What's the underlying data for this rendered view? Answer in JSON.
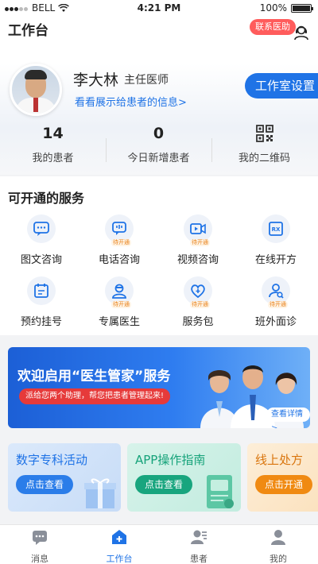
{
  "status_bar": {
    "carrier": "BELL",
    "time": "4:21 PM",
    "battery": "100%"
  },
  "header": {
    "title": "工作台",
    "contact_button": "联系医助",
    "support_icon": "headset-user-icon",
    "doctor": {
      "name": "李大林",
      "position": "主任医师",
      "info_link": "看看展示给患者的信息>"
    },
    "studio_button": "工作室设置",
    "stats": [
      {
        "value": "14",
        "label": "我的患者"
      },
      {
        "value": "0",
        "label": "今日新增患者"
      },
      {
        "icon": "qr-code-icon",
        "label": "我的二维码"
      }
    ]
  },
  "services": {
    "title": "可开通的服务",
    "items": [
      {
        "label": "图文咨询",
        "icon": "chat-icon",
        "badge": ""
      },
      {
        "label": "电话咨询",
        "icon": "phone-chat-icon",
        "badge": "待开通"
      },
      {
        "label": "视频咨询",
        "icon": "video-icon",
        "badge": "待开通"
      },
      {
        "label": "在线开方",
        "icon": "prescription-icon",
        "badge": ""
      },
      {
        "label": "预约挂号",
        "icon": "calendar-icon",
        "badge": ""
      },
      {
        "label": "专属医生",
        "icon": "doctor-icon",
        "badge": "待开通"
      },
      {
        "label": "服务包",
        "icon": "heart-plus-icon",
        "badge": "待开通"
      },
      {
        "label": "班外面诊",
        "icon": "search-person-icon",
        "badge": "待开通"
      }
    ]
  },
  "banner": {
    "title": "欢迎启用“医生管家”服务",
    "subtitle": "派给您两个助理，帮您把患者管理起来!",
    "more_button": "查看详情 >"
  },
  "cards": [
    {
      "title": "数字专科活动",
      "button": "点击查看"
    },
    {
      "title": "APP操作指南",
      "button": "点击查看"
    },
    {
      "title": "线上处方",
      "button": "点击开通"
    }
  ],
  "tabbar": {
    "items": [
      {
        "label": "消息",
        "icon": "message-icon"
      },
      {
        "label": "工作台",
        "icon": "workbench-icon"
      },
      {
        "label": "患者",
        "icon": "patients-icon"
      },
      {
        "label": "我的",
        "icon": "profile-icon"
      }
    ],
    "active": "工作台"
  },
  "colors": {
    "primary": "#1f73e6",
    "danger": "#ff5c5c",
    "badge": "#e8821c",
    "green": "#18a57e",
    "orange": "#f08a12"
  }
}
